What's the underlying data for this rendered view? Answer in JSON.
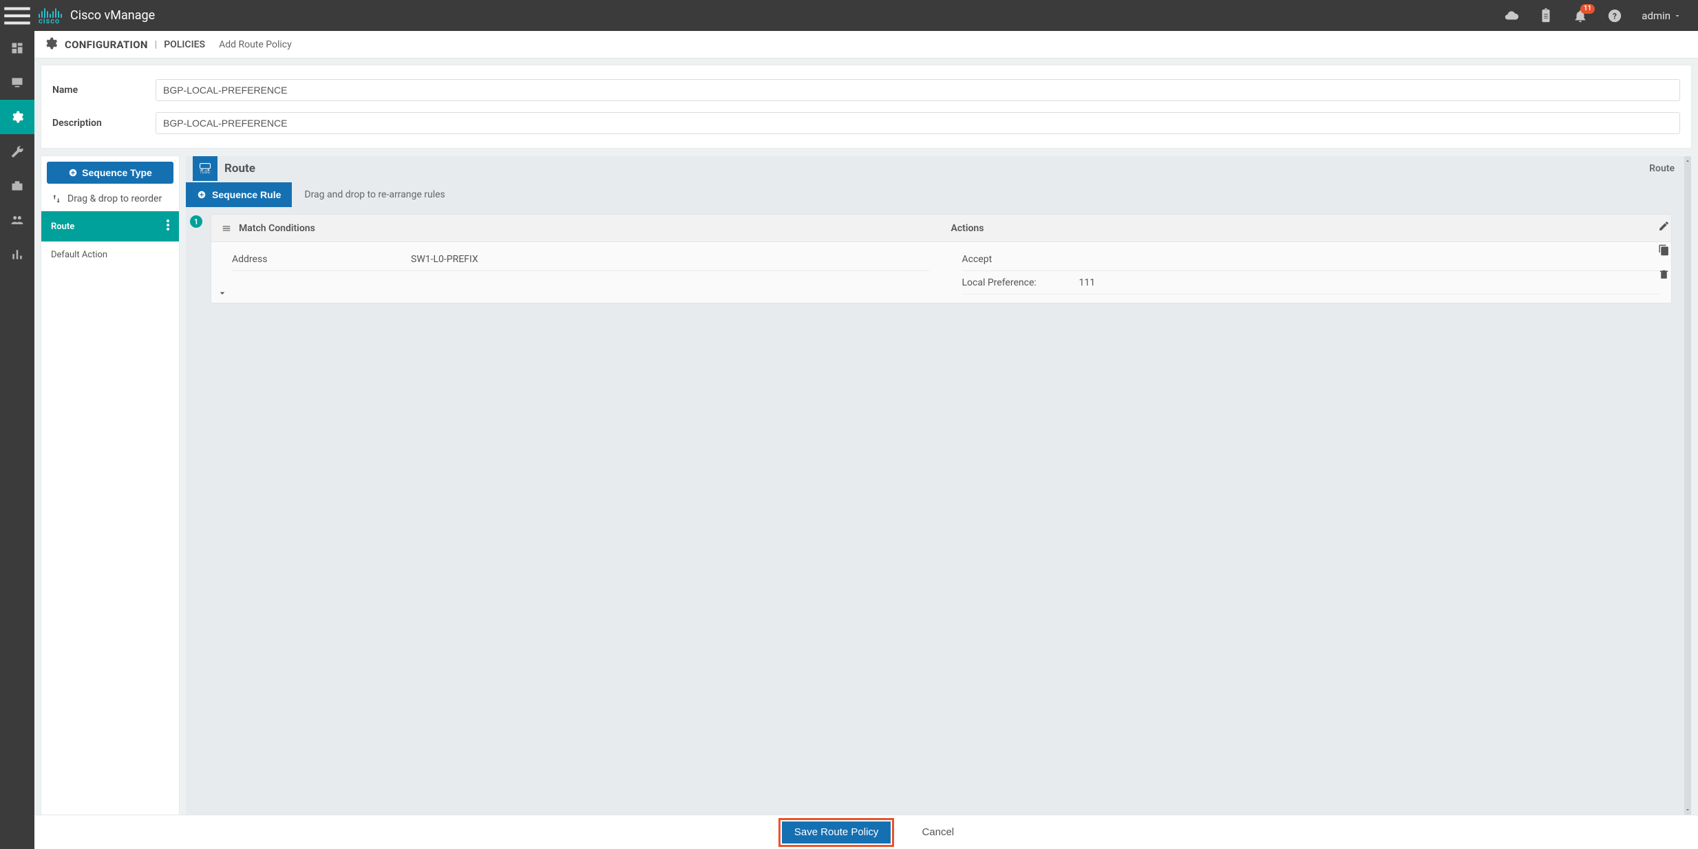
{
  "topbar": {
    "product": "Cisco vManage",
    "logo_text": "cisco",
    "notification_count": "11",
    "user": "admin"
  },
  "leftrail": {
    "items": [
      {
        "name": "dashboard"
      },
      {
        "name": "monitor"
      },
      {
        "name": "configuration",
        "active": true
      },
      {
        "name": "tools"
      },
      {
        "name": "maintenance"
      },
      {
        "name": "administration"
      },
      {
        "name": "analytics"
      }
    ]
  },
  "breadcrumb": {
    "section": "CONFIGURATION",
    "subsection": "POLICIES",
    "page": "Add Route Policy"
  },
  "form": {
    "name_label": "Name",
    "name_value": "BGP-LOCAL-PREFERENCE",
    "desc_label": "Description",
    "desc_value": "BGP-LOCAL-PREFERENCE"
  },
  "seq_panel": {
    "seq_type_label": "Sequence Type",
    "drag_hint": "Drag & drop to reorder",
    "route_label": "Route",
    "default_action_label": "Default Action"
  },
  "rules": {
    "tloc_label": "TLOC",
    "title": "Route",
    "header_right": "Route",
    "seq_rule_label": "Sequence Rule",
    "hint": "Drag and drop to re-arrange rules",
    "rule_number": "1",
    "match_header": "Match Conditions",
    "actions_header": "Actions",
    "match": [
      {
        "k": "Address",
        "v": "SW1-L0-PREFIX"
      }
    ],
    "actions": [
      {
        "k": "Accept",
        "v": ""
      },
      {
        "k": "Local Preference:",
        "v": "111"
      }
    ]
  },
  "footer": {
    "save": "Save Route Policy",
    "cancel": "Cancel"
  }
}
